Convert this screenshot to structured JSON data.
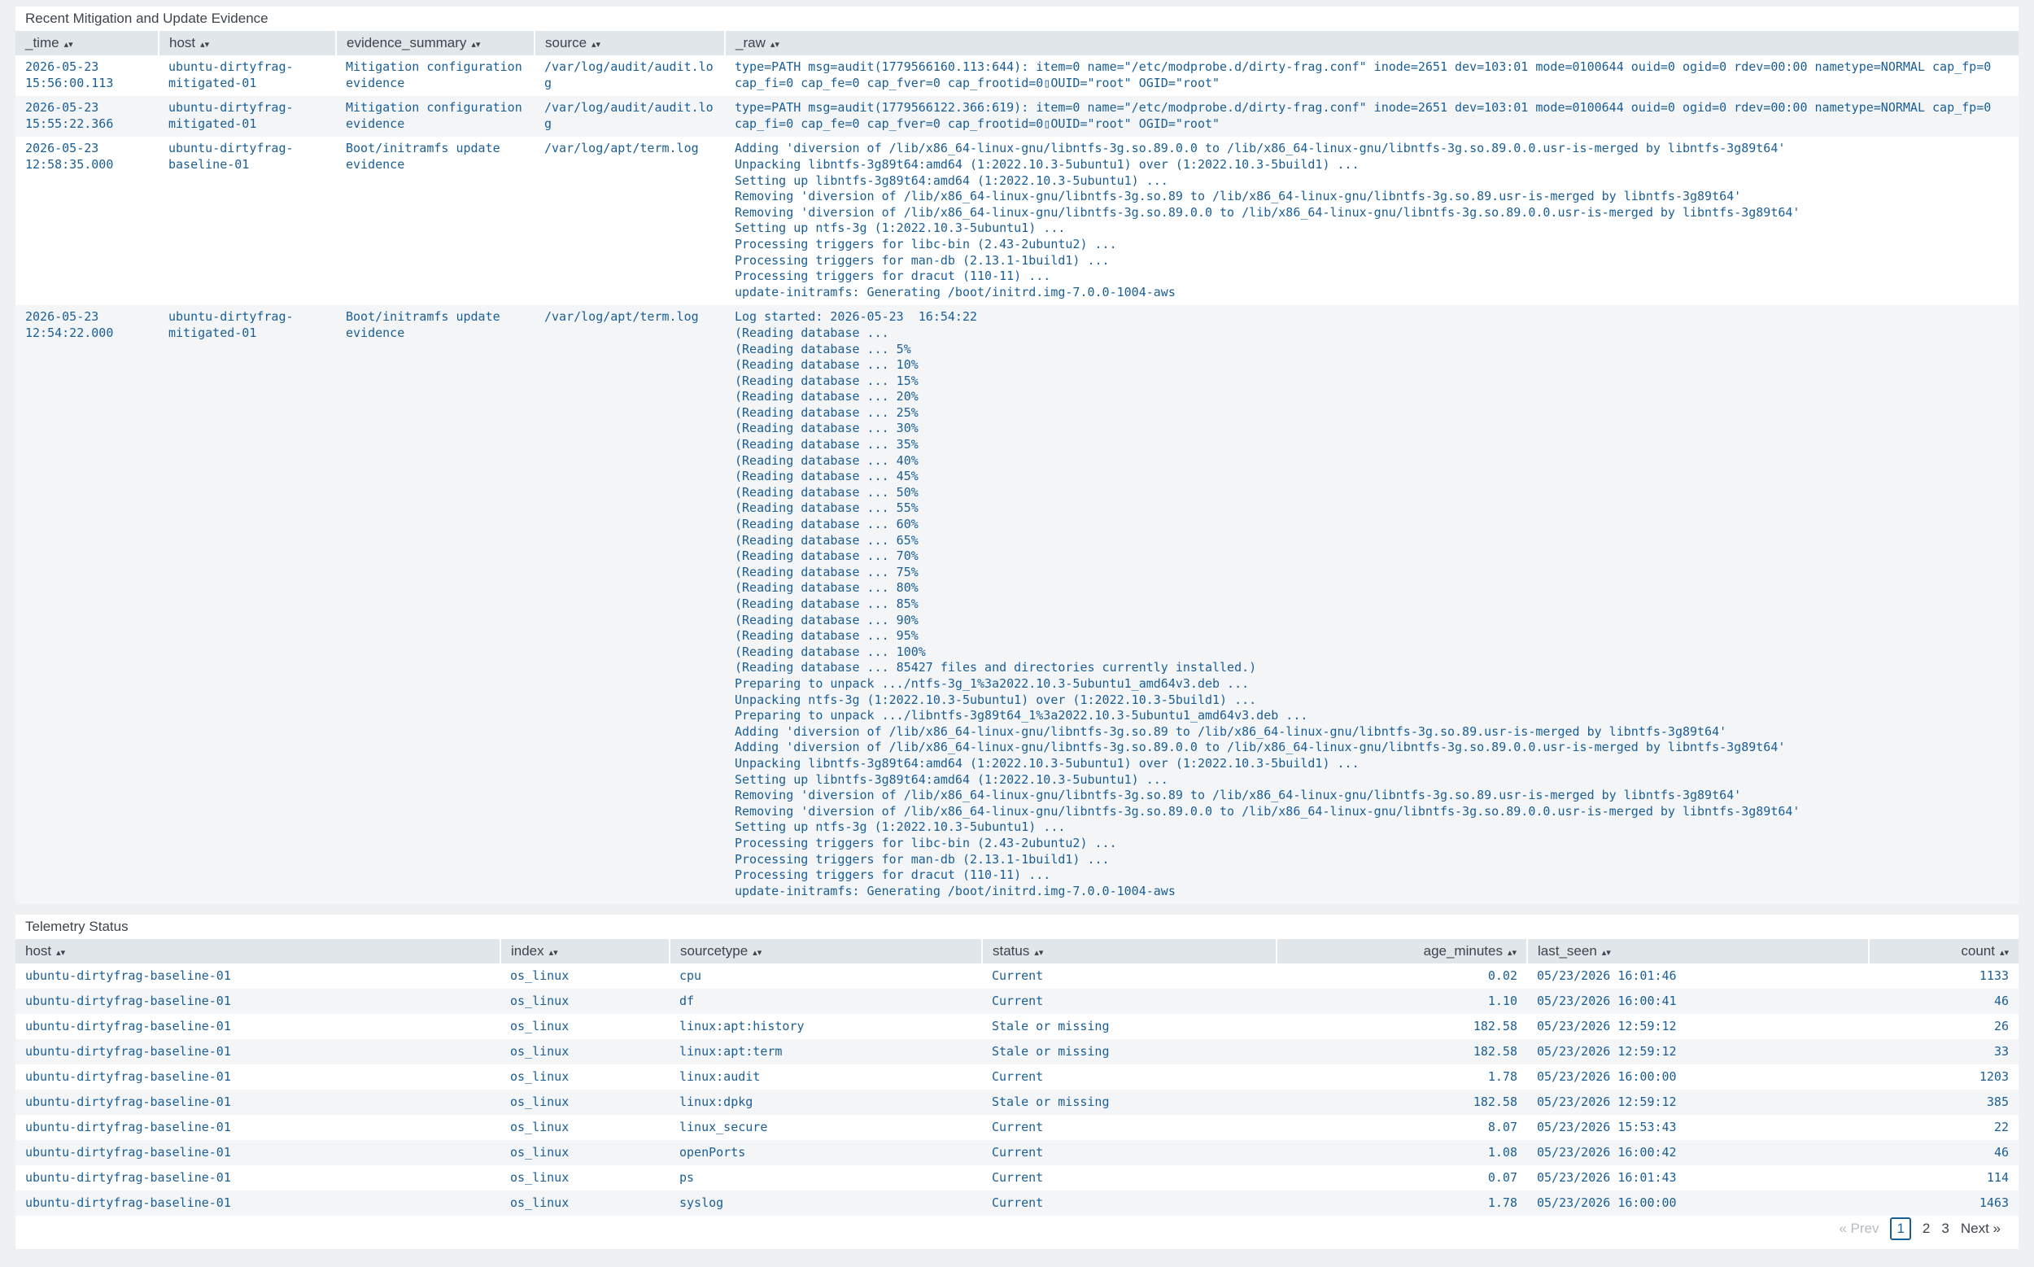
{
  "evidence_panel": {
    "title": "Recent Mitigation and Update Evidence",
    "columns": [
      "_time",
      "host",
      "evidence_summary",
      "source",
      "_raw"
    ],
    "rows": [
      {
        "time": "2026-05-23 15:56:00.113",
        "host": "ubuntu-dirtyfrag-mitigated-01",
        "summary": "Mitigation configuration evidence",
        "source": "/var/log/audit/audit.log",
        "raw": "type=PATH msg=audit(1779566160.113:644): item=0 name=\"/etc/modprobe.d/dirty-frag.conf\" inode=2651 dev=103:01 mode=0100644 ouid=0 ogid=0 rdev=00:00 nametype=NORMAL cap_fp=0\ncap_fi=0 cap_fe=0 cap_fver=0 cap_frootid=0▯OUID=\"root\" OGID=\"root\""
      },
      {
        "time": "2026-05-23 15:55:22.366",
        "host": "ubuntu-dirtyfrag-mitigated-01",
        "summary": "Mitigation configuration evidence",
        "source": "/var/log/audit/audit.log",
        "raw": "type=PATH msg=audit(1779566122.366:619): item=0 name=\"/etc/modprobe.d/dirty-frag.conf\" inode=2651 dev=103:01 mode=0100644 ouid=0 ogid=0 rdev=00:00 nametype=NORMAL cap_fp=0\ncap_fi=0 cap_fe=0 cap_fver=0 cap_frootid=0▯OUID=\"root\" OGID=\"root\""
      },
      {
        "time": "2026-05-23 12:58:35.000",
        "host": "ubuntu-dirtyfrag-baseline-01",
        "summary": "Boot/initramfs update evidence",
        "source": "/var/log/apt/term.log",
        "raw": "Adding 'diversion of /lib/x86_64-linux-gnu/libntfs-3g.so.89.0.0 to /lib/x86_64-linux-gnu/libntfs-3g.so.89.0.0.usr-is-merged by libntfs-3g89t64'\nUnpacking libntfs-3g89t64:amd64 (1:2022.10.3-5ubuntu1) over (1:2022.10.3-5build1) ...\nSetting up libntfs-3g89t64:amd64 (1:2022.10.3-5ubuntu1) ...\nRemoving 'diversion of /lib/x86_64-linux-gnu/libntfs-3g.so.89 to /lib/x86_64-linux-gnu/libntfs-3g.so.89.usr-is-merged by libntfs-3g89t64'\nRemoving 'diversion of /lib/x86_64-linux-gnu/libntfs-3g.so.89.0.0 to /lib/x86_64-linux-gnu/libntfs-3g.so.89.0.0.usr-is-merged by libntfs-3g89t64'\nSetting up ntfs-3g (1:2022.10.3-5ubuntu1) ...\nProcessing triggers for libc-bin (2.43-2ubuntu2) ...\nProcessing triggers for man-db (2.13.1-1build1) ...\nProcessing triggers for dracut (110-11) ...\nupdate-initramfs: Generating /boot/initrd.img-7.0.0-1004-aws"
      },
      {
        "time": "2026-05-23 12:54:22.000",
        "host": "ubuntu-dirtyfrag-mitigated-01",
        "summary": "Boot/initramfs update evidence",
        "source": "/var/log/apt/term.log",
        "raw": "Log started: 2026-05-23  16:54:22\n(Reading database ...\n(Reading database ... 5%\n(Reading database ... 10%\n(Reading database ... 15%\n(Reading database ... 20%\n(Reading database ... 25%\n(Reading database ... 30%\n(Reading database ... 35%\n(Reading database ... 40%\n(Reading database ... 45%\n(Reading database ... 50%\n(Reading database ... 55%\n(Reading database ... 60%\n(Reading database ... 65%\n(Reading database ... 70%\n(Reading database ... 75%\n(Reading database ... 80%\n(Reading database ... 85%\n(Reading database ... 90%\n(Reading database ... 95%\n(Reading database ... 100%\n(Reading database ... 85427 files and directories currently installed.)\nPreparing to unpack .../ntfs-3g_1%3a2022.10.3-5ubuntu1_amd64v3.deb ...\nUnpacking ntfs-3g (1:2022.10.3-5ubuntu1) over (1:2022.10.3-5build1) ...\nPreparing to unpack .../libntfs-3g89t64_1%3a2022.10.3-5ubuntu1_amd64v3.deb ...\nAdding 'diversion of /lib/x86_64-linux-gnu/libntfs-3g.so.89 to /lib/x86_64-linux-gnu/libntfs-3g.so.89.usr-is-merged by libntfs-3g89t64'\nAdding 'diversion of /lib/x86_64-linux-gnu/libntfs-3g.so.89.0.0 to /lib/x86_64-linux-gnu/libntfs-3g.so.89.0.0.usr-is-merged by libntfs-3g89t64'\nUnpacking libntfs-3g89t64:amd64 (1:2022.10.3-5ubuntu1) over (1:2022.10.3-5build1) ...\nSetting up libntfs-3g89t64:amd64 (1:2022.10.3-5ubuntu1) ...\nRemoving 'diversion of /lib/x86_64-linux-gnu/libntfs-3g.so.89 to /lib/x86_64-linux-gnu/libntfs-3g.so.89.usr-is-merged by libntfs-3g89t64'\nRemoving 'diversion of /lib/x86_64-linux-gnu/libntfs-3g.so.89.0.0 to /lib/x86_64-linux-gnu/libntfs-3g.so.89.0.0.usr-is-merged by libntfs-3g89t64'\nSetting up ntfs-3g (1:2022.10.3-5ubuntu1) ...\nProcessing triggers for libc-bin (2.43-2ubuntu2) ...\nProcessing triggers for man-db (2.13.1-1build1) ...\nProcessing triggers for dracut (110-11) ...\nupdate-initramfs: Generating /boot/initrd.img-7.0.0-1004-aws"
      }
    ]
  },
  "telemetry_panel": {
    "title": "Telemetry Status",
    "columns": [
      "host",
      "index",
      "sourcetype",
      "status",
      "age_minutes",
      "last_seen",
      "count"
    ],
    "rows": [
      {
        "host": "ubuntu-dirtyfrag-baseline-01",
        "index": "os_linux",
        "sourcetype": "cpu",
        "status": "Current",
        "age": "0.02",
        "last_seen": "05/23/2026 16:01:46",
        "count": "1133"
      },
      {
        "host": "ubuntu-dirtyfrag-baseline-01",
        "index": "os_linux",
        "sourcetype": "df",
        "status": "Current",
        "age": "1.10",
        "last_seen": "05/23/2026 16:00:41",
        "count": "46"
      },
      {
        "host": "ubuntu-dirtyfrag-baseline-01",
        "index": "os_linux",
        "sourcetype": "linux:apt:history",
        "status": "Stale or missing",
        "age": "182.58",
        "last_seen": "05/23/2026 12:59:12",
        "count": "26"
      },
      {
        "host": "ubuntu-dirtyfrag-baseline-01",
        "index": "os_linux",
        "sourcetype": "linux:apt:term",
        "status": "Stale or missing",
        "age": "182.58",
        "last_seen": "05/23/2026 12:59:12",
        "count": "33"
      },
      {
        "host": "ubuntu-dirtyfrag-baseline-01",
        "index": "os_linux",
        "sourcetype": "linux:audit",
        "status": "Current",
        "age": "1.78",
        "last_seen": "05/23/2026 16:00:00",
        "count": "1203"
      },
      {
        "host": "ubuntu-dirtyfrag-baseline-01",
        "index": "os_linux",
        "sourcetype": "linux:dpkg",
        "status": "Stale or missing",
        "age": "182.58",
        "last_seen": "05/23/2026 12:59:12",
        "count": "385"
      },
      {
        "host": "ubuntu-dirtyfrag-baseline-01",
        "index": "os_linux",
        "sourcetype": "linux_secure",
        "status": "Current",
        "age": "8.07",
        "last_seen": "05/23/2026 15:53:43",
        "count": "22"
      },
      {
        "host": "ubuntu-dirtyfrag-baseline-01",
        "index": "os_linux",
        "sourcetype": "openPorts",
        "status": "Current",
        "age": "1.08",
        "last_seen": "05/23/2026 16:00:42",
        "count": "46"
      },
      {
        "host": "ubuntu-dirtyfrag-baseline-01",
        "index": "os_linux",
        "sourcetype": "ps",
        "status": "Current",
        "age": "0.07",
        "last_seen": "05/23/2026 16:01:43",
        "count": "114"
      },
      {
        "host": "ubuntu-dirtyfrag-baseline-01",
        "index": "os_linux",
        "sourcetype": "syslog",
        "status": "Current",
        "age": "1.78",
        "last_seen": "05/23/2026 16:00:00",
        "count": "1463"
      }
    ],
    "pager": {
      "prev": "« Prev",
      "pages": [
        "1",
        "2",
        "3"
      ],
      "current": "1",
      "next": "Next »"
    }
  },
  "icons": {
    "sort": "sort-icon"
  }
}
